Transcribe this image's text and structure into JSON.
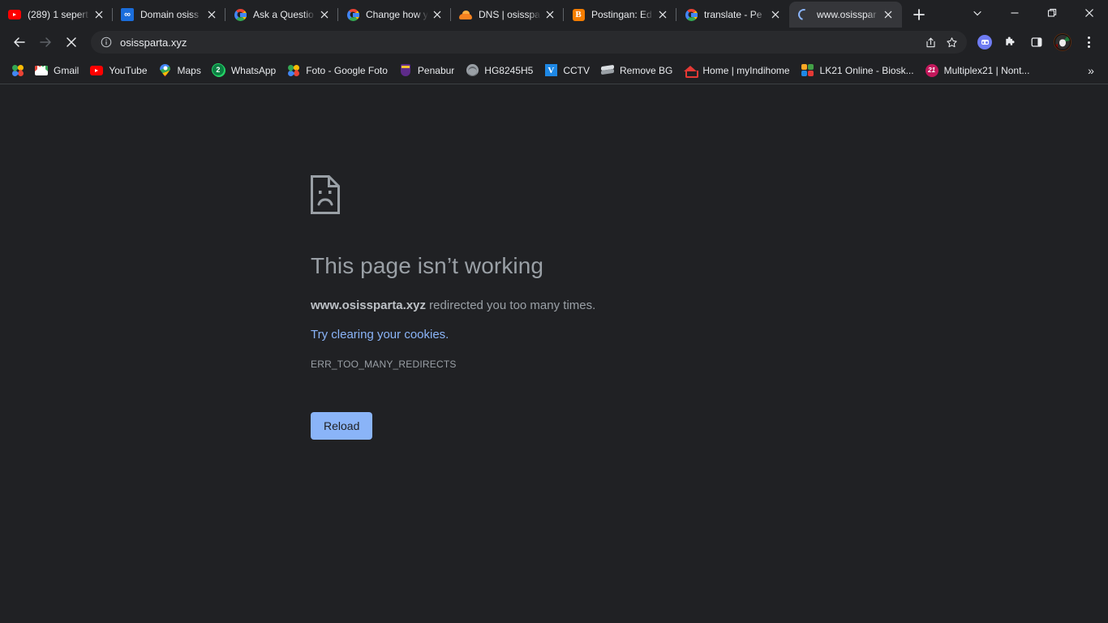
{
  "window": {
    "controls": [
      {
        "name": "tab-search-button",
        "icon": "chevron-down-icon"
      },
      {
        "name": "minimize-button",
        "icon": "minimize-icon"
      },
      {
        "name": "maximize-button",
        "icon": "maximize-icon"
      },
      {
        "name": "close-button",
        "icon": "close-icon"
      }
    ]
  },
  "tabstrip": {
    "new_tab_label": "+",
    "tabs": [
      {
        "title": "(289) 1 sepert",
        "favicon": "youtube-icon",
        "active": false
      },
      {
        "title": "Domain osiss",
        "favicon": "domain-registrar-icon",
        "active": false
      },
      {
        "title": "Ask a Questio",
        "favicon": "google-icon",
        "active": false
      },
      {
        "title": "Change how y",
        "favicon": "google-icon",
        "active": false
      },
      {
        "title": "DNS | osisspa",
        "favicon": "cloudflare-icon",
        "active": false
      },
      {
        "title": "Postingan: Ed",
        "favicon": "blogger-icon",
        "active": false
      },
      {
        "title": "translate - Pe",
        "favicon": "google-icon",
        "active": false
      },
      {
        "title": "www.osisspar",
        "favicon": "loading-spinner-icon",
        "active": true
      }
    ]
  },
  "toolbar": {
    "back_label": "Back",
    "forward_label": "Forward",
    "stop_label": "Stop",
    "url": "osissparta.xyz",
    "site_info_icon": "info-circle-icon",
    "share_label": "Share",
    "bookmark_label": "Bookmark this tab",
    "extensions_label": "Extensions",
    "side_panel_label": "Side panel",
    "profile_label": "Profile",
    "menu_label": "Customize and control Google Chrome"
  },
  "bookmarks": {
    "overflow_label": "»",
    "items": [
      {
        "label": "",
        "icon": "google-photos-icon",
        "icon_only": true
      },
      {
        "label": "Gmail",
        "icon": "gmail-icon",
        "icon_only": false
      },
      {
        "label": "YouTube",
        "icon": "youtube-icon",
        "icon_only": false
      },
      {
        "label": "Maps",
        "icon": "google-maps-icon",
        "icon_only": false
      },
      {
        "label": "WhatsApp",
        "icon": "whatsapp-icon",
        "icon_only": false,
        "badge": "2"
      },
      {
        "label": "Foto - Google Foto",
        "icon": "google-photos-icon",
        "icon_only": false
      },
      {
        "label": "Penabur",
        "icon": "penabur-icon",
        "icon_only": false
      },
      {
        "label": "HG8245H5",
        "icon": "globe-icon",
        "icon_only": false
      },
      {
        "label": "CCTV",
        "icon": "cctv-icon",
        "icon_only": false
      },
      {
        "label": "Remove BG",
        "icon": "remove-bg-icon",
        "icon_only": false
      },
      {
        "label": "Home | myIndihome",
        "icon": "home-icon",
        "icon_only": false
      },
      {
        "label": "LK21 Online - Biosk...",
        "icon": "lk21-icon",
        "icon_only": false
      },
      {
        "label": "Multiplex21 | Nont...",
        "icon": "multiplex21-icon",
        "icon_only": false
      }
    ]
  },
  "error_page": {
    "icon": "sad-page-icon",
    "heading": "This page isn’t working",
    "message_domain": "www.osissparta.xyz",
    "message_rest": " redirected you too many times.",
    "link_text": "Try clearing your cookies.",
    "error_code": "ERR_TOO_MANY_REDIRECTS",
    "reload_label": "Reload"
  },
  "colors": {
    "chrome_bg": "#202124",
    "active_tab": "#35363A",
    "omnibox_bg": "#292A2D",
    "text_primary": "#E8EAED",
    "text_secondary": "#9AA0A6",
    "accent_blue": "#8AB4F8",
    "divider": "#3C4043"
  }
}
